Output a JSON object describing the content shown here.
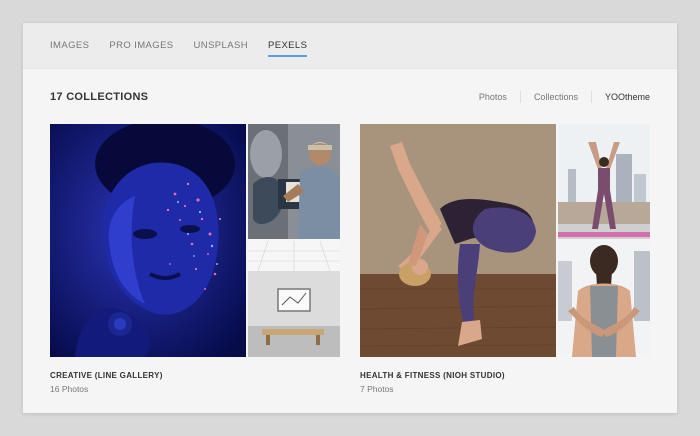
{
  "tabs": [
    {
      "label": "IMAGES",
      "active": false
    },
    {
      "label": "PRO IMAGES",
      "active": false
    },
    {
      "label": "UNSPLASH",
      "active": false
    },
    {
      "label": "PEXELS",
      "active": true
    }
  ],
  "collections_count": "17 COLLECTIONS",
  "filters": [
    {
      "label": "Photos",
      "active": false
    },
    {
      "label": "Collections",
      "active": false
    },
    {
      "label": "YOOtheme",
      "active": true
    }
  ],
  "cards": [
    {
      "title": "CREATIVE (LINE GALLERY)",
      "subtitle": "16 Photos",
      "images": [
        "glitter-face-portrait-photo",
        "graffiti-artist-photo",
        "gallery-bench-photo"
      ]
    },
    {
      "title": "HEALTH & FITNESS (NIOH STUDIO)",
      "subtitle": "7 Photos",
      "images": [
        "yoga-bend-pose-photo",
        "rooftop-yoga-photo",
        "yoga-back-stretch-photo"
      ]
    }
  ],
  "colors": {
    "accent": "#5aa1e3",
    "page_bg": "#d9d9d9",
    "panel_bg": "#f5f5f5"
  }
}
